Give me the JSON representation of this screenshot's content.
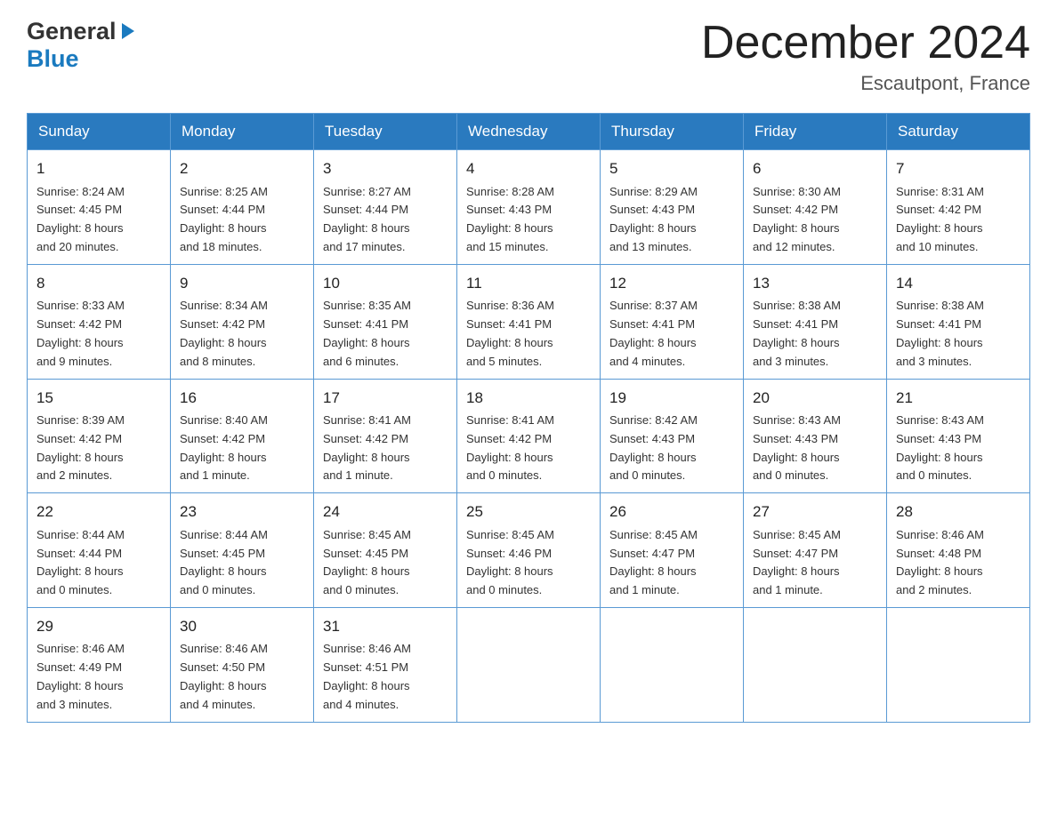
{
  "header": {
    "logo_line1": "General",
    "logo_line2": "Blue",
    "month_title": "December 2024",
    "location": "Escautpont, France"
  },
  "days_of_week": [
    "Sunday",
    "Monday",
    "Tuesday",
    "Wednesday",
    "Thursday",
    "Friday",
    "Saturday"
  ],
  "weeks": [
    [
      {
        "day": "1",
        "sunrise": "Sunrise: 8:24 AM",
        "sunset": "Sunset: 4:45 PM",
        "daylight": "Daylight: 8 hours",
        "daylight2": "and 20 minutes."
      },
      {
        "day": "2",
        "sunrise": "Sunrise: 8:25 AM",
        "sunset": "Sunset: 4:44 PM",
        "daylight": "Daylight: 8 hours",
        "daylight2": "and 18 minutes."
      },
      {
        "day": "3",
        "sunrise": "Sunrise: 8:27 AM",
        "sunset": "Sunset: 4:44 PM",
        "daylight": "Daylight: 8 hours",
        "daylight2": "and 17 minutes."
      },
      {
        "day": "4",
        "sunrise": "Sunrise: 8:28 AM",
        "sunset": "Sunset: 4:43 PM",
        "daylight": "Daylight: 8 hours",
        "daylight2": "and 15 minutes."
      },
      {
        "day": "5",
        "sunrise": "Sunrise: 8:29 AM",
        "sunset": "Sunset: 4:43 PM",
        "daylight": "Daylight: 8 hours",
        "daylight2": "and 13 minutes."
      },
      {
        "day": "6",
        "sunrise": "Sunrise: 8:30 AM",
        "sunset": "Sunset: 4:42 PM",
        "daylight": "Daylight: 8 hours",
        "daylight2": "and 12 minutes."
      },
      {
        "day": "7",
        "sunrise": "Sunrise: 8:31 AM",
        "sunset": "Sunset: 4:42 PM",
        "daylight": "Daylight: 8 hours",
        "daylight2": "and 10 minutes."
      }
    ],
    [
      {
        "day": "8",
        "sunrise": "Sunrise: 8:33 AM",
        "sunset": "Sunset: 4:42 PM",
        "daylight": "Daylight: 8 hours",
        "daylight2": "and 9 minutes."
      },
      {
        "day": "9",
        "sunrise": "Sunrise: 8:34 AM",
        "sunset": "Sunset: 4:42 PM",
        "daylight": "Daylight: 8 hours",
        "daylight2": "and 8 minutes."
      },
      {
        "day": "10",
        "sunrise": "Sunrise: 8:35 AM",
        "sunset": "Sunset: 4:41 PM",
        "daylight": "Daylight: 8 hours",
        "daylight2": "and 6 minutes."
      },
      {
        "day": "11",
        "sunrise": "Sunrise: 8:36 AM",
        "sunset": "Sunset: 4:41 PM",
        "daylight": "Daylight: 8 hours",
        "daylight2": "and 5 minutes."
      },
      {
        "day": "12",
        "sunrise": "Sunrise: 8:37 AM",
        "sunset": "Sunset: 4:41 PM",
        "daylight": "Daylight: 8 hours",
        "daylight2": "and 4 minutes."
      },
      {
        "day": "13",
        "sunrise": "Sunrise: 8:38 AM",
        "sunset": "Sunset: 4:41 PM",
        "daylight": "Daylight: 8 hours",
        "daylight2": "and 3 minutes."
      },
      {
        "day": "14",
        "sunrise": "Sunrise: 8:38 AM",
        "sunset": "Sunset: 4:41 PM",
        "daylight": "Daylight: 8 hours",
        "daylight2": "and 3 minutes."
      }
    ],
    [
      {
        "day": "15",
        "sunrise": "Sunrise: 8:39 AM",
        "sunset": "Sunset: 4:42 PM",
        "daylight": "Daylight: 8 hours",
        "daylight2": "and 2 minutes."
      },
      {
        "day": "16",
        "sunrise": "Sunrise: 8:40 AM",
        "sunset": "Sunset: 4:42 PM",
        "daylight": "Daylight: 8 hours",
        "daylight2": "and 1 minute."
      },
      {
        "day": "17",
        "sunrise": "Sunrise: 8:41 AM",
        "sunset": "Sunset: 4:42 PM",
        "daylight": "Daylight: 8 hours",
        "daylight2": "and 1 minute."
      },
      {
        "day": "18",
        "sunrise": "Sunrise: 8:41 AM",
        "sunset": "Sunset: 4:42 PM",
        "daylight": "Daylight: 8 hours",
        "daylight2": "and 0 minutes."
      },
      {
        "day": "19",
        "sunrise": "Sunrise: 8:42 AM",
        "sunset": "Sunset: 4:43 PM",
        "daylight": "Daylight: 8 hours",
        "daylight2": "and 0 minutes."
      },
      {
        "day": "20",
        "sunrise": "Sunrise: 8:43 AM",
        "sunset": "Sunset: 4:43 PM",
        "daylight": "Daylight: 8 hours",
        "daylight2": "and 0 minutes."
      },
      {
        "day": "21",
        "sunrise": "Sunrise: 8:43 AM",
        "sunset": "Sunset: 4:43 PM",
        "daylight": "Daylight: 8 hours",
        "daylight2": "and 0 minutes."
      }
    ],
    [
      {
        "day": "22",
        "sunrise": "Sunrise: 8:44 AM",
        "sunset": "Sunset: 4:44 PM",
        "daylight": "Daylight: 8 hours",
        "daylight2": "and 0 minutes."
      },
      {
        "day": "23",
        "sunrise": "Sunrise: 8:44 AM",
        "sunset": "Sunset: 4:45 PM",
        "daylight": "Daylight: 8 hours",
        "daylight2": "and 0 minutes."
      },
      {
        "day": "24",
        "sunrise": "Sunrise: 8:45 AM",
        "sunset": "Sunset: 4:45 PM",
        "daylight": "Daylight: 8 hours",
        "daylight2": "and 0 minutes."
      },
      {
        "day": "25",
        "sunrise": "Sunrise: 8:45 AM",
        "sunset": "Sunset: 4:46 PM",
        "daylight": "Daylight: 8 hours",
        "daylight2": "and 0 minutes."
      },
      {
        "day": "26",
        "sunrise": "Sunrise: 8:45 AM",
        "sunset": "Sunset: 4:47 PM",
        "daylight": "Daylight: 8 hours",
        "daylight2": "and 1 minute."
      },
      {
        "day": "27",
        "sunrise": "Sunrise: 8:45 AM",
        "sunset": "Sunset: 4:47 PM",
        "daylight": "Daylight: 8 hours",
        "daylight2": "and 1 minute."
      },
      {
        "day": "28",
        "sunrise": "Sunrise: 8:46 AM",
        "sunset": "Sunset: 4:48 PM",
        "daylight": "Daylight: 8 hours",
        "daylight2": "and 2 minutes."
      }
    ],
    [
      {
        "day": "29",
        "sunrise": "Sunrise: 8:46 AM",
        "sunset": "Sunset: 4:49 PM",
        "daylight": "Daylight: 8 hours",
        "daylight2": "and 3 minutes."
      },
      {
        "day": "30",
        "sunrise": "Sunrise: 8:46 AM",
        "sunset": "Sunset: 4:50 PM",
        "daylight": "Daylight: 8 hours",
        "daylight2": "and 4 minutes."
      },
      {
        "day": "31",
        "sunrise": "Sunrise: 8:46 AM",
        "sunset": "Sunset: 4:51 PM",
        "daylight": "Daylight: 8 hours",
        "daylight2": "and 4 minutes."
      },
      null,
      null,
      null,
      null
    ]
  ]
}
